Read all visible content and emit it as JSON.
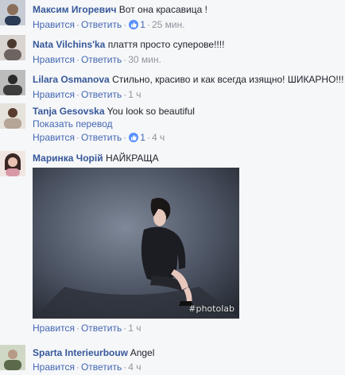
{
  "actions": {
    "like": "Нравится",
    "reply": "Ответить",
    "separator": "·"
  },
  "comments": [
    {
      "author": "Максим Игоревич",
      "text": "Вот она красавица !",
      "likes": "1",
      "time": "25 мин.",
      "has_like_badge": true,
      "avatar_icon": "user-avatar"
    },
    {
      "author": "Nata Vilchins'ka",
      "text": "плаття просто суперове!!!!",
      "time": "30 мин.",
      "has_like_badge": false,
      "avatar_icon": "user-avatar"
    },
    {
      "author": "Lilara Osmanova",
      "text": "Стильно, красиво и как всегда изящно! ШИКАРНО!!!",
      "time": "1 ч",
      "has_like_badge": false,
      "avatar_icon": "user-avatar"
    },
    {
      "author": "Tanja Gesovska",
      "text": "You look so beautiful",
      "translate": "Показать перевод",
      "likes": "1",
      "time": "4 ч",
      "has_like_badge": true,
      "avatar_icon": "user-avatar"
    },
    {
      "author": "Маринка Чорій",
      "text": "НАЙКРАЩА",
      "time": "1 ч",
      "has_like_badge": false,
      "avatar_icon": "user-avatar",
      "photo_watermark": "#photolab"
    },
    {
      "author": "Sparta Interieurbouw",
      "text": "Angel",
      "time": "4 ч",
      "has_like_badge": false,
      "avatar_icon": "user-avatar"
    }
  ],
  "colors": {
    "author": "#365899",
    "link": "#4267b2",
    "meta": "#90949c",
    "like_badge": "#5890ff",
    "background": "#f6f7f9"
  }
}
